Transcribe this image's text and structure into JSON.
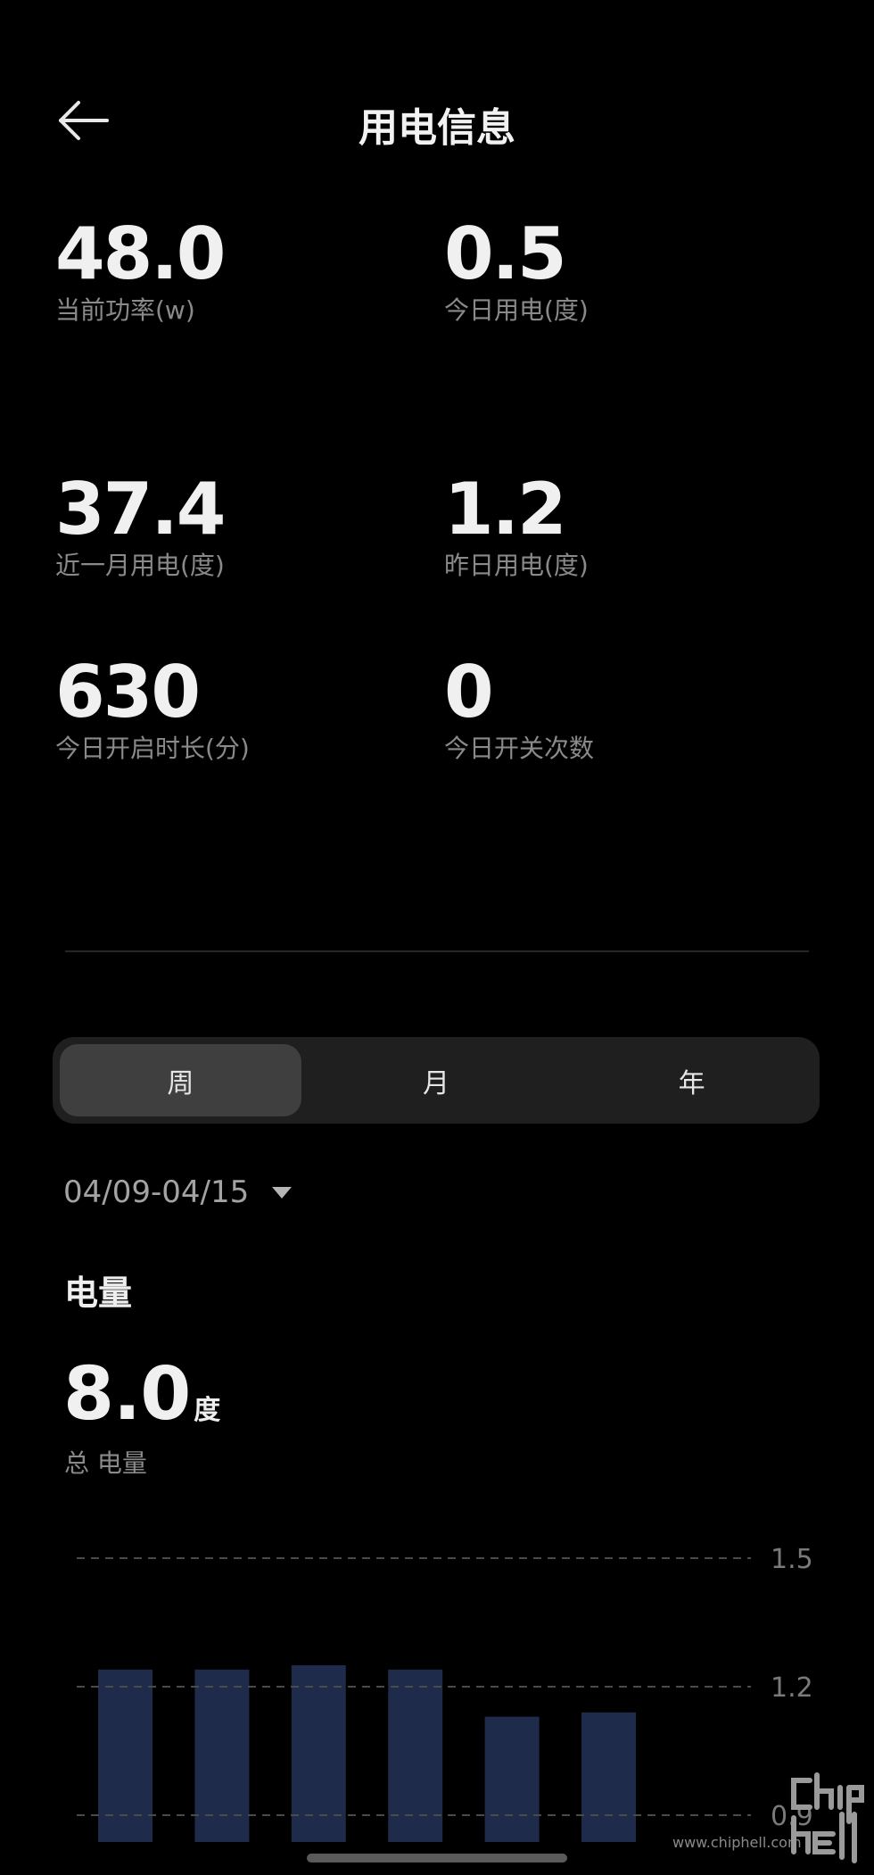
{
  "header": {
    "title": "用电信息"
  },
  "stats": {
    "current_power": {
      "value": "48.0",
      "label": "当前功率(w)"
    },
    "today_usage": {
      "value": "0.5",
      "label": "今日用电(度)"
    },
    "month_usage": {
      "value": "37.4",
      "label": "近一月用电(度)"
    },
    "yesterday_usage": {
      "value": "1.2",
      "label": "昨日用电(度)"
    },
    "today_on_duration": {
      "value": "630",
      "label": "今日开启时长(分)"
    },
    "today_switch_count": {
      "value": "0",
      "label": "今日开关次数"
    }
  },
  "tabs": [
    {
      "label": "周",
      "active": true
    },
    {
      "label": "月",
      "active": false
    },
    {
      "label": "年",
      "active": false
    }
  ],
  "date_range": "04/09-04/15",
  "section_title": "电量",
  "total": {
    "value": "8.0",
    "unit": "度",
    "label": "总 电量"
  },
  "chart_data": {
    "type": "bar",
    "x": [
      1,
      2,
      3,
      4,
      5,
      6
    ],
    "values": [
      1.24,
      1.24,
      1.25,
      1.24,
      1.13,
      1.14
    ],
    "title": "",
    "xlabel": "",
    "ylabel": "",
    "ylim": [
      0.9,
      1.5
    ],
    "yticks": [
      1.5,
      1.2,
      0.9
    ],
    "ytick_labels": [
      "1.5",
      "1.2",
      "0.9"
    ],
    "grid": true,
    "gridline_style": "dashed",
    "bar_color": "#1e2b4a"
  },
  "colors": {
    "background": "#000000",
    "bar": "#1e2b4a",
    "segmented_bg": "#1f1f1f",
    "segmented_active": "#3f3f3f"
  },
  "watermark": {
    "text": "www.chiphell.com"
  }
}
